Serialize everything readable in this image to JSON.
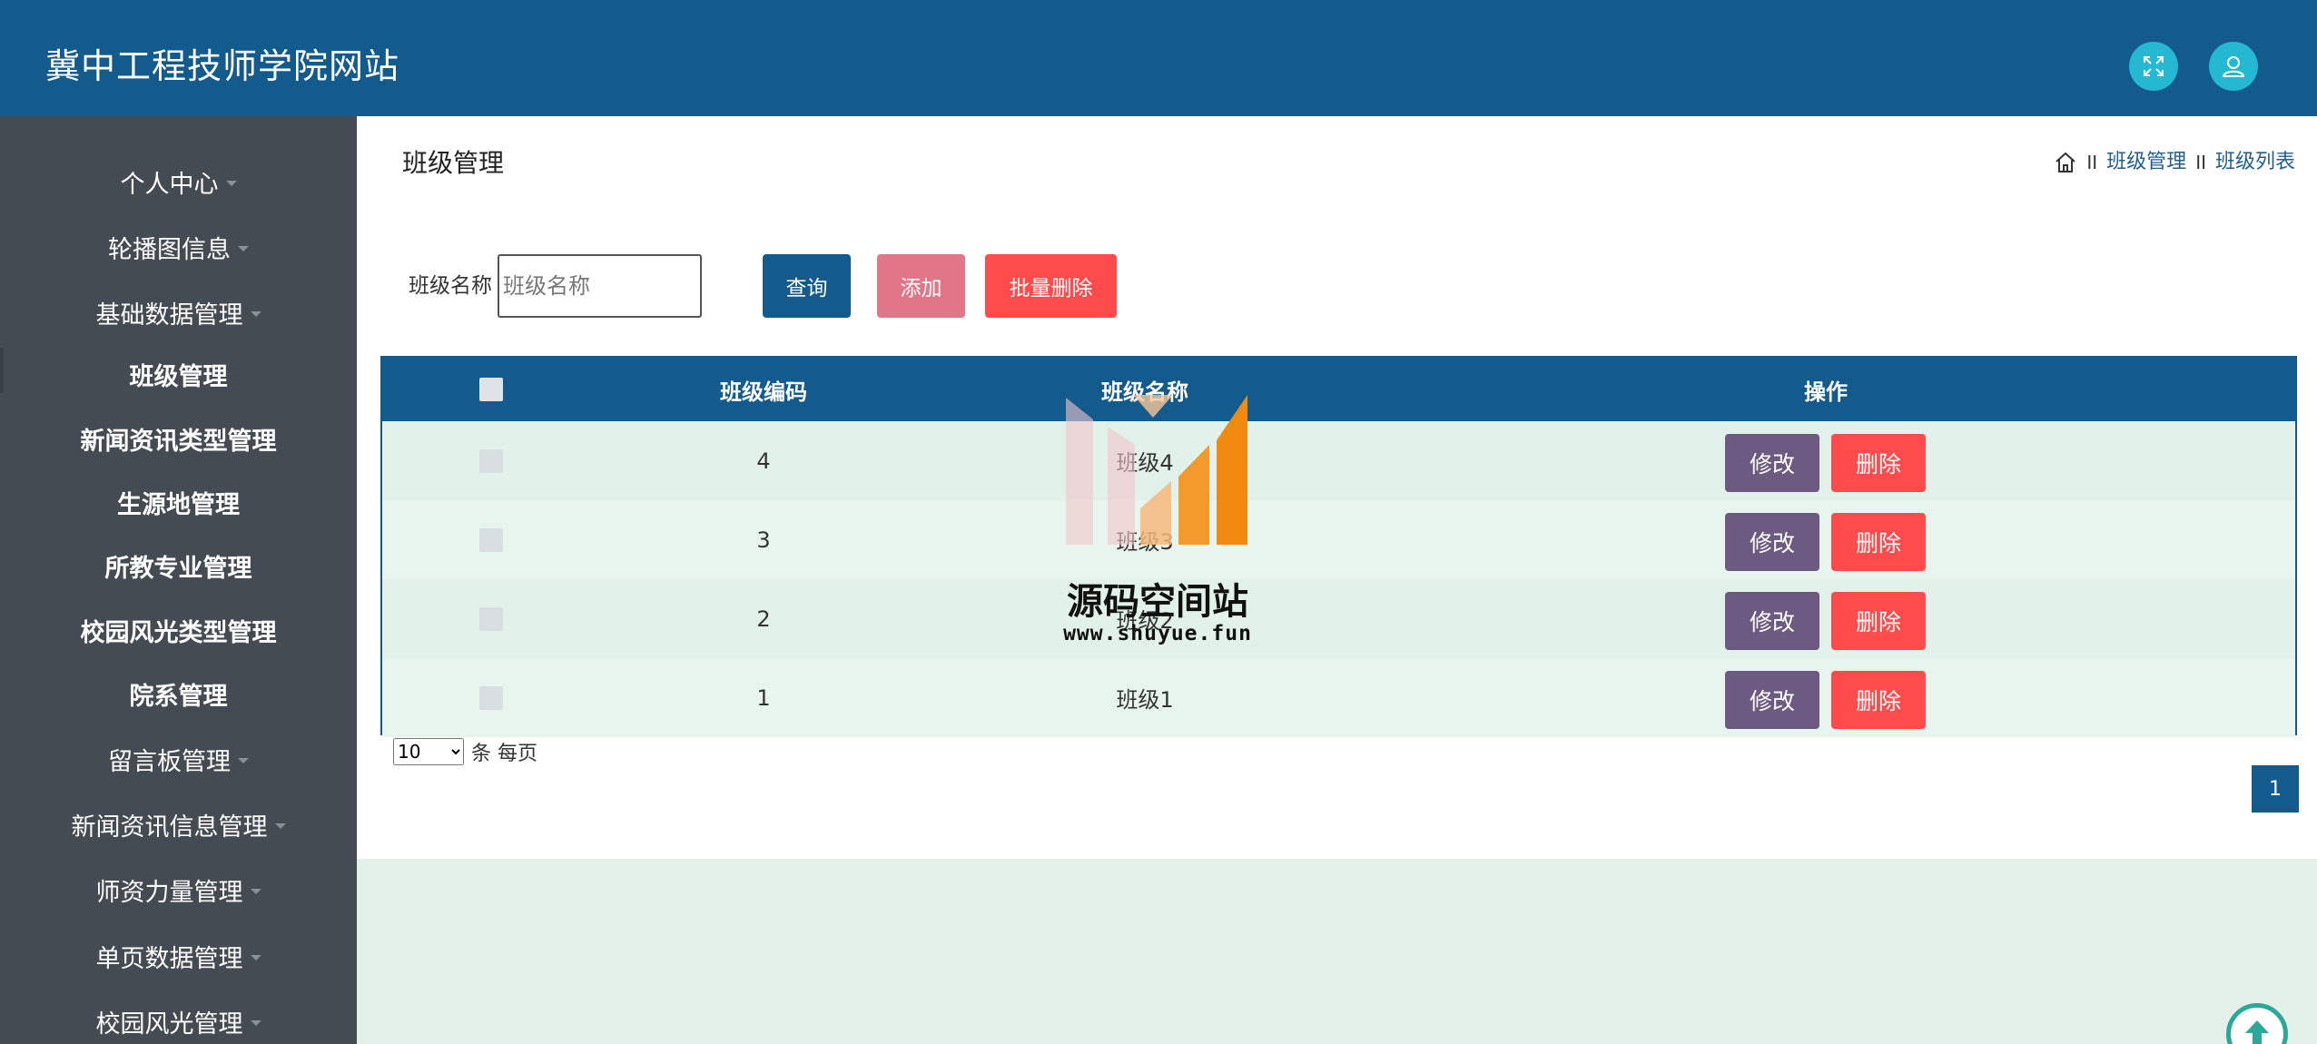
{
  "header": {
    "site_title": "冀中工程技师学院网站",
    "fullscreen_icon": "expand-icon",
    "user_icon": "user-icon"
  },
  "sidebar": {
    "items": [
      {
        "label": "个人中心",
        "has_caret": true
      },
      {
        "label": "轮播图信息",
        "has_caret": true
      },
      {
        "label": "基础数据管理",
        "has_caret": true
      },
      {
        "label": "班级管理",
        "has_caret": false,
        "active": true
      },
      {
        "label": "新闻资讯类型管理",
        "has_caret": false
      },
      {
        "label": "生源地管理",
        "has_caret": false
      },
      {
        "label": "所教专业管理",
        "has_caret": false
      },
      {
        "label": "校园风光类型管理",
        "has_caret": false
      },
      {
        "label": "院系管理",
        "has_caret": false
      },
      {
        "label": "留言板管理",
        "has_caret": true
      },
      {
        "label": "新闻资讯信息管理",
        "has_caret": true
      },
      {
        "label": "师资力量管理",
        "has_caret": true
      },
      {
        "label": "单页数据管理",
        "has_caret": true
      },
      {
        "label": "校园风光管理",
        "has_caret": true
      }
    ]
  },
  "main": {
    "page_title": "班级管理",
    "breadcrumb": {
      "home_icon": "home-icon",
      "separator": "II",
      "items": [
        "班级管理",
        "班级列表"
      ]
    },
    "search": {
      "label": "班级名称",
      "placeholder": "班级名称",
      "value": ""
    },
    "buttons": {
      "query": "查询",
      "add": "添加",
      "batch_delete": "批量删除"
    },
    "table": {
      "headers": [
        "班级编码",
        "班级名称",
        "操作"
      ],
      "rows": [
        {
          "code": "4",
          "name": "班级4"
        },
        {
          "code": "3",
          "name": "班级3"
        },
        {
          "code": "2",
          "name": "班级2"
        },
        {
          "code": "1",
          "name": "班级1"
        }
      ],
      "edit_label": "修改",
      "delete_label": "删除"
    },
    "pagination": {
      "page_size": "10",
      "page_size_suffix": "条 每页",
      "current_page": "1"
    }
  },
  "watermark": {
    "text": "源码空间站",
    "url": "www.shuyue.fun"
  },
  "colors": {
    "primary": "#135a8d",
    "sidebar_bg": "#454b53",
    "danger": "#ff4b4b",
    "edit": "#6c5a80",
    "add": "#e07688",
    "accent_cyan": "#24b8d3"
  }
}
